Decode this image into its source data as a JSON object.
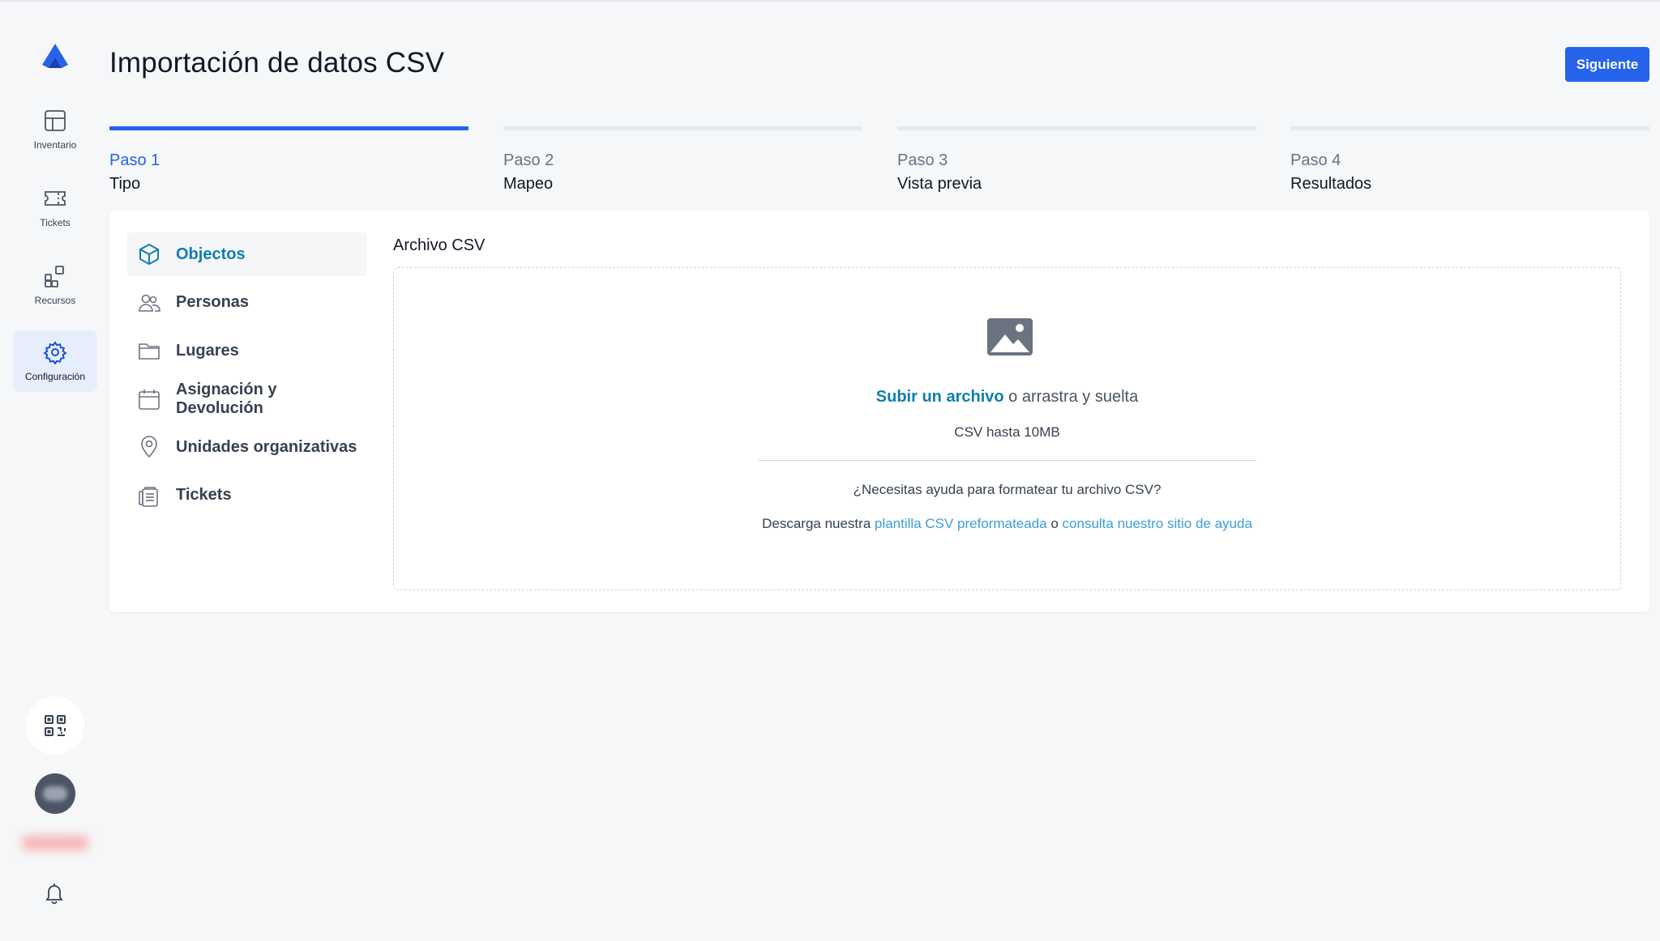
{
  "page": {
    "title": "Importación de datos CSV",
    "next_label": "Siguiente"
  },
  "sidebar": {
    "items": [
      {
        "label": "Inventario",
        "icon": "grid-icon"
      },
      {
        "label": "Tickets",
        "icon": "ticket-icon"
      },
      {
        "label": "Recursos",
        "icon": "apps-icon"
      },
      {
        "label": "Configuración",
        "icon": "gear-icon",
        "active": true
      }
    ]
  },
  "steps": [
    {
      "number": "Paso 1",
      "name": "Tipo",
      "current": true
    },
    {
      "number": "Paso 2",
      "name": "Mapeo"
    },
    {
      "number": "Paso 3",
      "name": "Vista previa"
    },
    {
      "number": "Paso 4",
      "name": "Resultados"
    }
  ],
  "types": [
    {
      "label": "Objectos",
      "icon": "cube-icon",
      "active": true
    },
    {
      "label": "Personas",
      "icon": "users-icon"
    },
    {
      "label": "Lugares",
      "icon": "folder-icon"
    },
    {
      "label": "Asignación y Devolución",
      "icon": "calendar-icon"
    },
    {
      "label": "Unidades organizativas",
      "icon": "location-pin-icon"
    },
    {
      "label": "Tickets",
      "icon": "clipboard-icon"
    }
  ],
  "upload": {
    "section_label": "Archivo CSV",
    "upload_link": "Subir un archivo",
    "drag_text": " o arrastra y suelta",
    "size_hint": "CSV hasta 10MB",
    "help_question": "¿Necesitas ayuda para formatear tu archivo CSV?",
    "download_prefix": "Descarga nuestra ",
    "template_link": "plantilla CSV preformateada",
    "connector": " o ",
    "help_link": "consulta nuestro sitio de ayuda"
  },
  "colors": {
    "accent": "#2563eb",
    "link": "#0e7fb0",
    "active_nav_bg": "#e6eefb"
  }
}
